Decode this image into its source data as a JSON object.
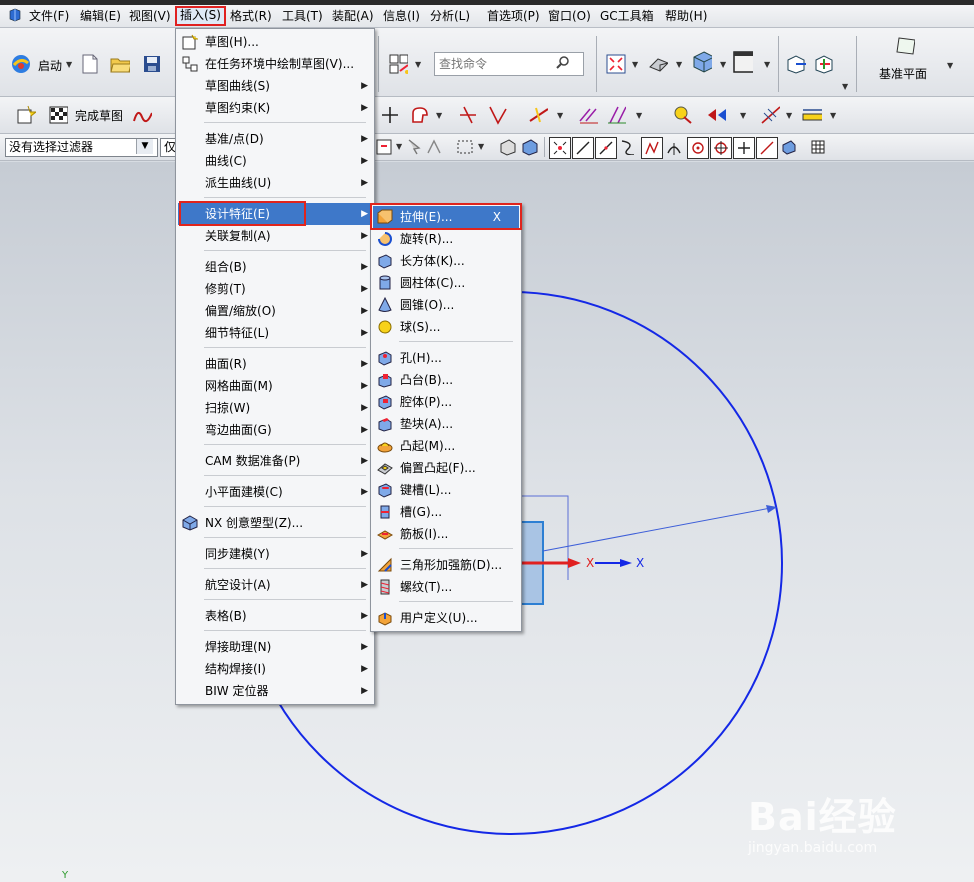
{
  "menubar": {
    "items": [
      {
        "label": "文件(F)"
      },
      {
        "label": "编辑(E)"
      },
      {
        "label": "视图(V)"
      },
      {
        "label": "插入(S)"
      },
      {
        "label": "格式(R)"
      },
      {
        "label": "工具(T)"
      },
      {
        "label": "装配(A)"
      },
      {
        "label": "信息(I)"
      },
      {
        "label": "分析(L)"
      },
      {
        "label": "首选项(P)"
      },
      {
        "label": "窗口(O)"
      },
      {
        "label": "GC工具箱"
      },
      {
        "label": "帮助(H)"
      }
    ]
  },
  "toolbar": {
    "start_label": "启动",
    "search_placeholder": "查找命令",
    "datum_plane_label": "基准平面",
    "finish_sketch_label": "完成草图",
    "filter_value": "没有选择过滤器",
    "second_select_value": "仅"
  },
  "insert_menu": {
    "items": [
      {
        "label": "草图(H)...",
        "icon": "sketch-icon"
      },
      {
        "label": "在任务环境中绘制草图(V)...",
        "icon": "sketch-task-icon"
      },
      {
        "label": "草图曲线(S)"
      },
      {
        "label": "草图约束(K)"
      },
      {
        "label": "基准/点(D)"
      },
      {
        "label": "曲线(C)"
      },
      {
        "label": "派生曲线(U)"
      },
      {
        "label": "设计特征(E)"
      },
      {
        "label": "关联复制(A)"
      },
      {
        "label": "组合(B)"
      },
      {
        "label": "修剪(T)"
      },
      {
        "label": "偏置/缩放(O)"
      },
      {
        "label": "细节特征(L)"
      },
      {
        "label": "曲面(R)"
      },
      {
        "label": "网格曲面(M)"
      },
      {
        "label": "扫掠(W)"
      },
      {
        "label": "弯边曲面(G)"
      },
      {
        "label": "CAM 数据准备(P)"
      },
      {
        "label": "小平面建模(C)"
      },
      {
        "label": "NX 创意塑型(Z)...",
        "icon": "nx-realize-shape-icon"
      },
      {
        "label": "同步建模(Y)"
      },
      {
        "label": "航空设计(A)"
      },
      {
        "label": "表格(B)"
      },
      {
        "label": "焊接助理(N)"
      },
      {
        "label": "结构焊接(I)"
      },
      {
        "label": "BIW 定位器"
      }
    ]
  },
  "design_feature_menu": {
    "items": [
      {
        "label": "拉伸(E)...",
        "shortcut": "X",
        "icon": "extrude-icon"
      },
      {
        "label": "旋转(R)...",
        "icon": "revolve-icon"
      },
      {
        "label": "长方体(K)...",
        "icon": "block-icon"
      },
      {
        "label": "圆柱体(C)...",
        "icon": "cylinder-icon"
      },
      {
        "label": "圆锥(O)...",
        "icon": "cone-icon"
      },
      {
        "label": "球(S)...",
        "icon": "sphere-icon"
      },
      {
        "label": "孔(H)...",
        "icon": "hole-icon"
      },
      {
        "label": "凸台(B)...",
        "icon": "boss-icon"
      },
      {
        "label": "腔体(P)...",
        "icon": "pocket-icon"
      },
      {
        "label": "垫块(A)...",
        "icon": "pad-icon"
      },
      {
        "label": "凸起(M)...",
        "icon": "emboss-icon"
      },
      {
        "label": "偏置凸起(F)...",
        "icon": "offset-emboss-icon"
      },
      {
        "label": "键槽(L)...",
        "icon": "slot-icon"
      },
      {
        "label": "槽(G)...",
        "icon": "groove-icon"
      },
      {
        "label": "筋板(I)...",
        "icon": "rib-icon"
      },
      {
        "label": "三角形加强筋(D)...",
        "icon": "dart-icon"
      },
      {
        "label": "螺纹(T)...",
        "icon": "thread-icon"
      },
      {
        "label": "用户定义(U)...",
        "icon": "user-defined-icon"
      }
    ]
  },
  "viewport": {
    "axis_x_label_1": "X",
    "axis_x_label_2": "X",
    "bottom_axis_label": "Y"
  },
  "watermark": {
    "brand": "Bai经验",
    "url": "jingyan.baidu.com"
  },
  "colors": {
    "highlight": "#3e78c9",
    "red_marker": "#e0241c",
    "sketch_curve": "#1428e6"
  }
}
